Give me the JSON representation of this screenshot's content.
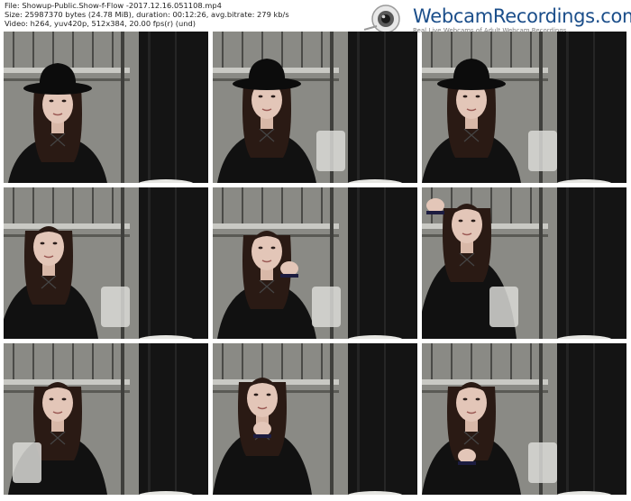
{
  "header": {
    "file_line": "File: Showup-Public.Show-f-Flow -2017.12.16.051108.mp4",
    "size_line": "Size: 25987370 bytes (24.78 MiB), duration: 00:12:26, avg.bitrate: 279 kb/s",
    "video_line": "Video: h264, yuv420p, 512x384, 20.00 fps(r) (und)"
  },
  "logo": {
    "text": "WebcamRecordings.com",
    "tagline": "Real Live Webcams of Adult Webcam Recordings",
    "icon": "webcam-icon"
  },
  "thumbnails": [
    {
      "pose": "hat-left"
    },
    {
      "pose": "hat-center"
    },
    {
      "pose": "hat-right"
    },
    {
      "pose": "hair-left"
    },
    {
      "pose": "hand-face"
    },
    {
      "pose": "arm-up"
    },
    {
      "pose": "hair-left-2"
    },
    {
      "pose": "hands-chin"
    },
    {
      "pose": "hand-chest"
    }
  ]
}
